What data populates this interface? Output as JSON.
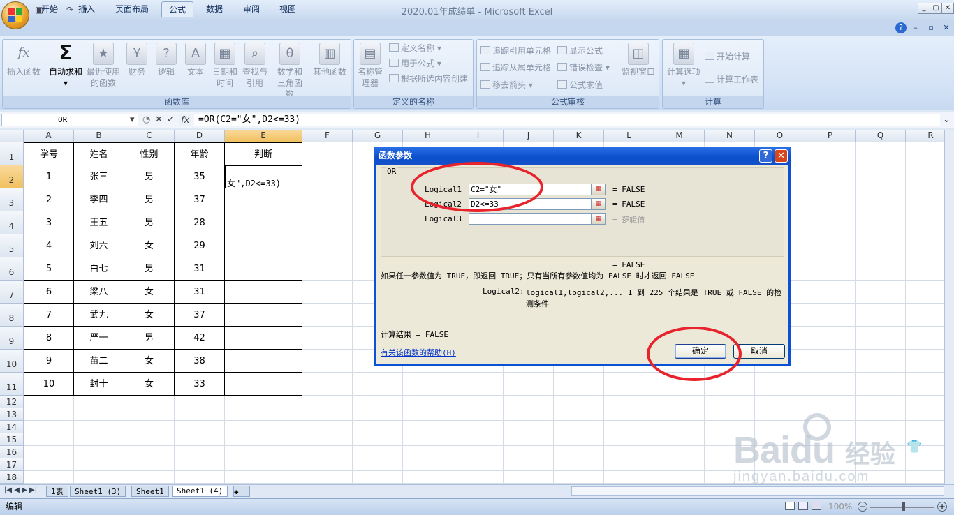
{
  "window": {
    "title": "2020.01年成绩单 - Microsoft Excel"
  },
  "ribbon": {
    "tabs": [
      "开始",
      "插入",
      "页面布局",
      "公式",
      "数据",
      "审阅",
      "视图"
    ],
    "active_tab": "公式",
    "groups": {
      "function_library": {
        "label": "函数库",
        "buttons": [
          "插入函数",
          "自动求和",
          "最近使用的函数",
          "财务",
          "逻辑",
          "文本",
          "日期和时间",
          "查找与引用",
          "数学和三角函数",
          "其他函数"
        ]
      },
      "defined_names": {
        "label": "定义的名称",
        "name_manager": "名称管理器",
        "items": [
          "定义名称",
          "用于公式",
          "根据所选内容创建"
        ]
      },
      "formula_auditing": {
        "label": "公式审核",
        "items": [
          "追踪引用单元格",
          "追踪从属单元格",
          "移去箭头",
          "显示公式",
          "错误检查",
          "公式求值"
        ],
        "watch_window": "监视窗口"
      },
      "calculation": {
        "label": "计算",
        "calc_options": "计算选项",
        "items": [
          "开始计算",
          "计算工作表"
        ]
      }
    }
  },
  "formula_bar": {
    "name_box": "OR",
    "formula": "=OR(C2=\"女\",D2<=33)"
  },
  "grid": {
    "columns": [
      "A",
      "B",
      "C",
      "D",
      "E",
      "F",
      "G",
      "H",
      "I",
      "J",
      "K",
      "L",
      "M",
      "N",
      "O",
      "P",
      "Q",
      "R"
    ],
    "rows": [
      "1",
      "2",
      "3",
      "4",
      "5",
      "6",
      "7",
      "8",
      "9",
      "10",
      "11",
      "12",
      "13",
      "14",
      "15",
      "16",
      "17",
      "18"
    ],
    "headers": [
      "学号",
      "姓名",
      "性别",
      "年龄",
      "判断"
    ],
    "data": [
      [
        "1",
        "张三",
        "男",
        "35"
      ],
      [
        "2",
        "李四",
        "男",
        "37"
      ],
      [
        "3",
        "王五",
        "男",
        "28"
      ],
      [
        "4",
        "刘六",
        "女",
        "29"
      ],
      [
        "5",
        "白七",
        "男",
        "31"
      ],
      [
        "6",
        "梁八",
        "女",
        "31"
      ],
      [
        "7",
        "武九",
        "女",
        "37"
      ],
      [
        "8",
        "严一",
        "男",
        "42"
      ],
      [
        "9",
        "苗二",
        "女",
        "38"
      ],
      [
        "10",
        "封十",
        "女",
        "33"
      ]
    ],
    "editing_cell_text": "女\",D2<=33)"
  },
  "sheet_tabs": [
    "1表",
    "Sheet1 (3)",
    "Sheet1",
    "Sheet1 (4)"
  ],
  "active_sheet": "Sheet1 (4)",
  "status": {
    "mode": "编辑",
    "zoom": "100%"
  },
  "dialog": {
    "title": "函数参数",
    "function": "OR",
    "args": [
      {
        "label": "Logical1",
        "value": "C2=\"女\"",
        "result": "= FALSE"
      },
      {
        "label": "Logical2",
        "value": "D2<=33",
        "result": "= FALSE"
      },
      {
        "label": "Logical3",
        "value": "",
        "result": "= 逻辑值"
      }
    ],
    "overall_result": "= FALSE",
    "description": "如果任一参数值为 TRUE，即返回 TRUE；只有当所有参数值均为 FALSE 时才返回 FALSE",
    "arg_help_label": "Logical2:",
    "arg_help_text": "logical1,logical2,... 1 到 225 个结果是 TRUE 或 FALSE 的检测条件",
    "calc_result": "计算结果 = FALSE",
    "help_link": "有关该函数的帮助(H)",
    "ok": "确定",
    "cancel": "取消"
  },
  "watermark": {
    "brand": "Baidu",
    "sub": "经验",
    "url": "jingyan.baidu.com"
  },
  "colors": {
    "accent": "#0a51d6",
    "annotation": "#e8232b"
  }
}
